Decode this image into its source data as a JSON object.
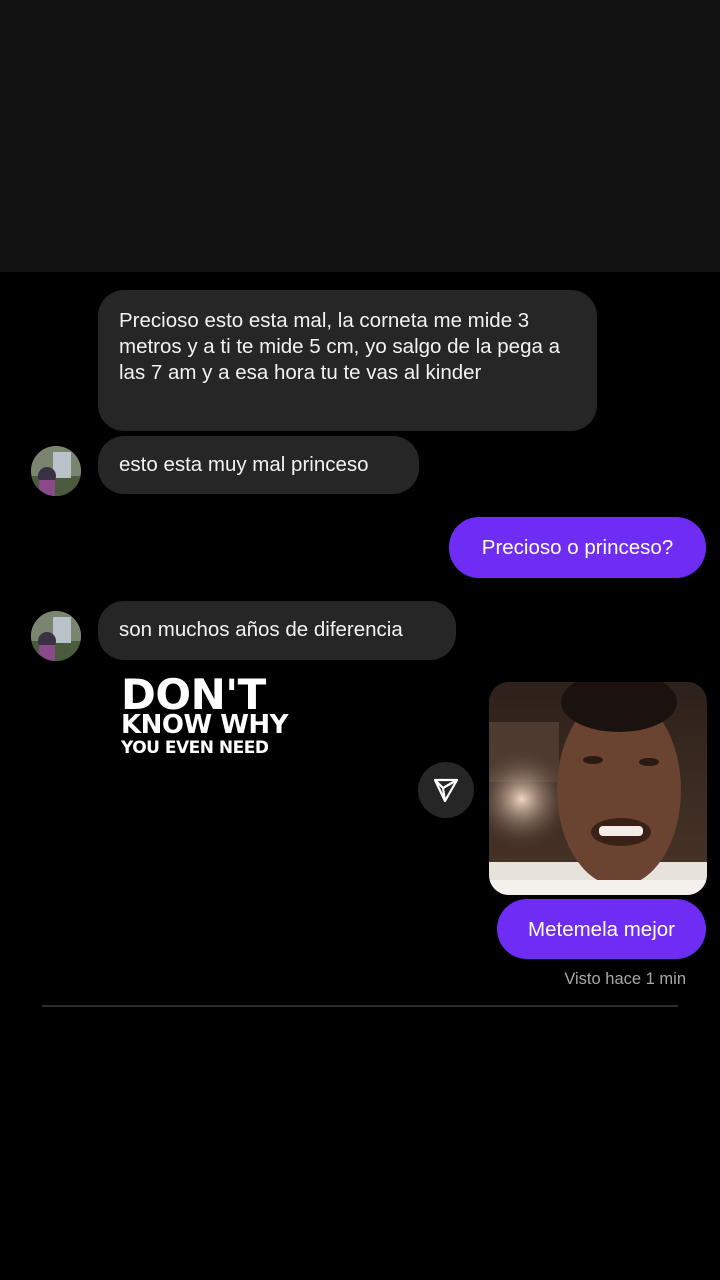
{
  "chat": {
    "messages": [
      {
        "from": "them",
        "text": "Precioso esto esta mal, la corneta me mide 3 metros y a ti te mide 5 cm, yo salgo de la pega a las 7 am y a esa hora tu te vas al kinder"
      },
      {
        "from": "them",
        "text": "esto esta muy mal princeso"
      },
      {
        "from": "me",
        "text": "Precioso o princeso?"
      },
      {
        "from": "them",
        "text": "son muchos años de diferencia"
      },
      {
        "from": "me",
        "text": "Metemela mejor"
      }
    ],
    "seen_status": "Visto hace 1 min"
  },
  "overlay": {
    "line1": "DON'T",
    "line2": "KNOW WHY",
    "line3": "YOU EVEN NEED"
  },
  "icons": {
    "share": "send-triangle-icon",
    "avatar": "contact-avatar"
  },
  "colors": {
    "background": "#000000",
    "top_band": "#121212",
    "incoming_bubble": "#262626",
    "outgoing_bubble": "#6f2cf5",
    "seen_text": "#a8a8a8"
  }
}
